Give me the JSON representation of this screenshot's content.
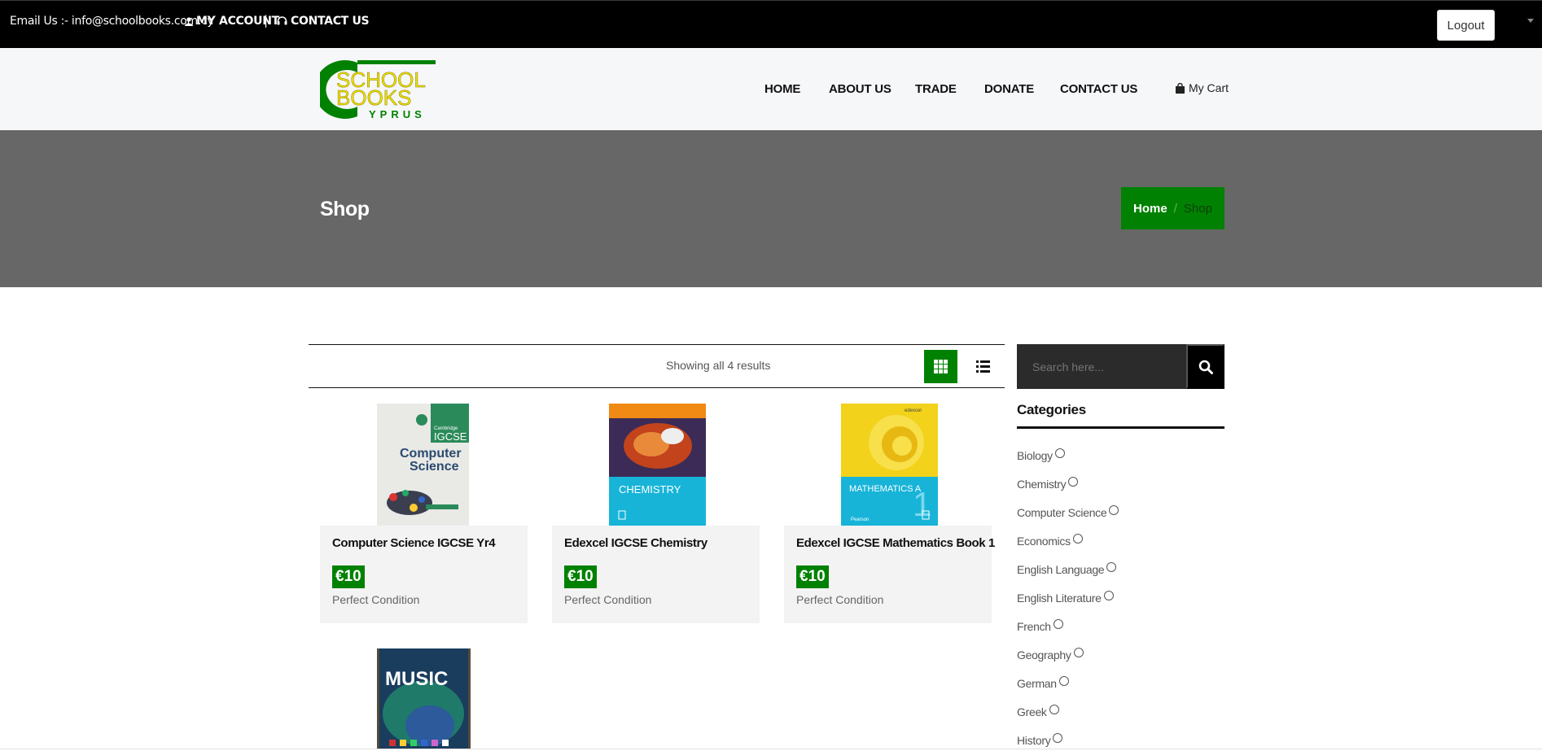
{
  "topbar": {
    "email": "Email Us :- info@schoolbooks.com.cy",
    "my_account": "MY ACCOUNT",
    "separator": "|",
    "contact": "CONTACT US",
    "logout": "Logout"
  },
  "logo": {
    "line1": "SCHOOL",
    "line2": "BOOKS",
    "line3": "YPRUS",
    "green": "#018101",
    "yellow": "#f0e000"
  },
  "nav": {
    "items": [
      "HOME",
      "ABOUT US",
      "TRADE",
      "DONATE",
      "CONTACT US"
    ],
    "cart": "My Cart"
  },
  "banner": {
    "title": "Shop",
    "breadcrumb": {
      "home": "Home",
      "separator": "/",
      "current": "Shop"
    }
  },
  "toolbar": {
    "results": "Showing all 4 results"
  },
  "products": [
    {
      "title": "Computer Science IGCSE Yr4",
      "price": "€10",
      "condition": "Perfect Condition"
    },
    {
      "title": "Edexcel IGCSE Chemistry",
      "price": "€10",
      "condition": "Perfect Condition"
    },
    {
      "title": "Edexcel IGCSE Mathematics Book 1",
      "price": "€10",
      "condition": "Perfect Condition"
    },
    {
      "title": "",
      "price": "",
      "condition": ""
    }
  ],
  "covers": {
    "cs": {
      "brand": "Cambridge",
      "tag": "IGCSE",
      "title1": "Computer",
      "title2": "Science"
    },
    "chem": {
      "title": "CHEMISTRY"
    },
    "math": {
      "brand": "edexcel",
      "title": "MATHEMATICS A",
      "number": "1",
      "publisher": "Pearson"
    },
    "music": {
      "title": "MUSIC"
    }
  },
  "sidebar": {
    "search_placeholder": "Search here...",
    "categories_title": "Categories",
    "categories": [
      "Biology",
      "Chemistry",
      "Computer Science",
      "Economics",
      "English Language",
      "English Literature",
      "French",
      "Geography",
      "German",
      "Greek",
      "History"
    ]
  },
  "colors": {
    "accent": "#018101",
    "banner": "#676767",
    "topbar": "#000000"
  }
}
